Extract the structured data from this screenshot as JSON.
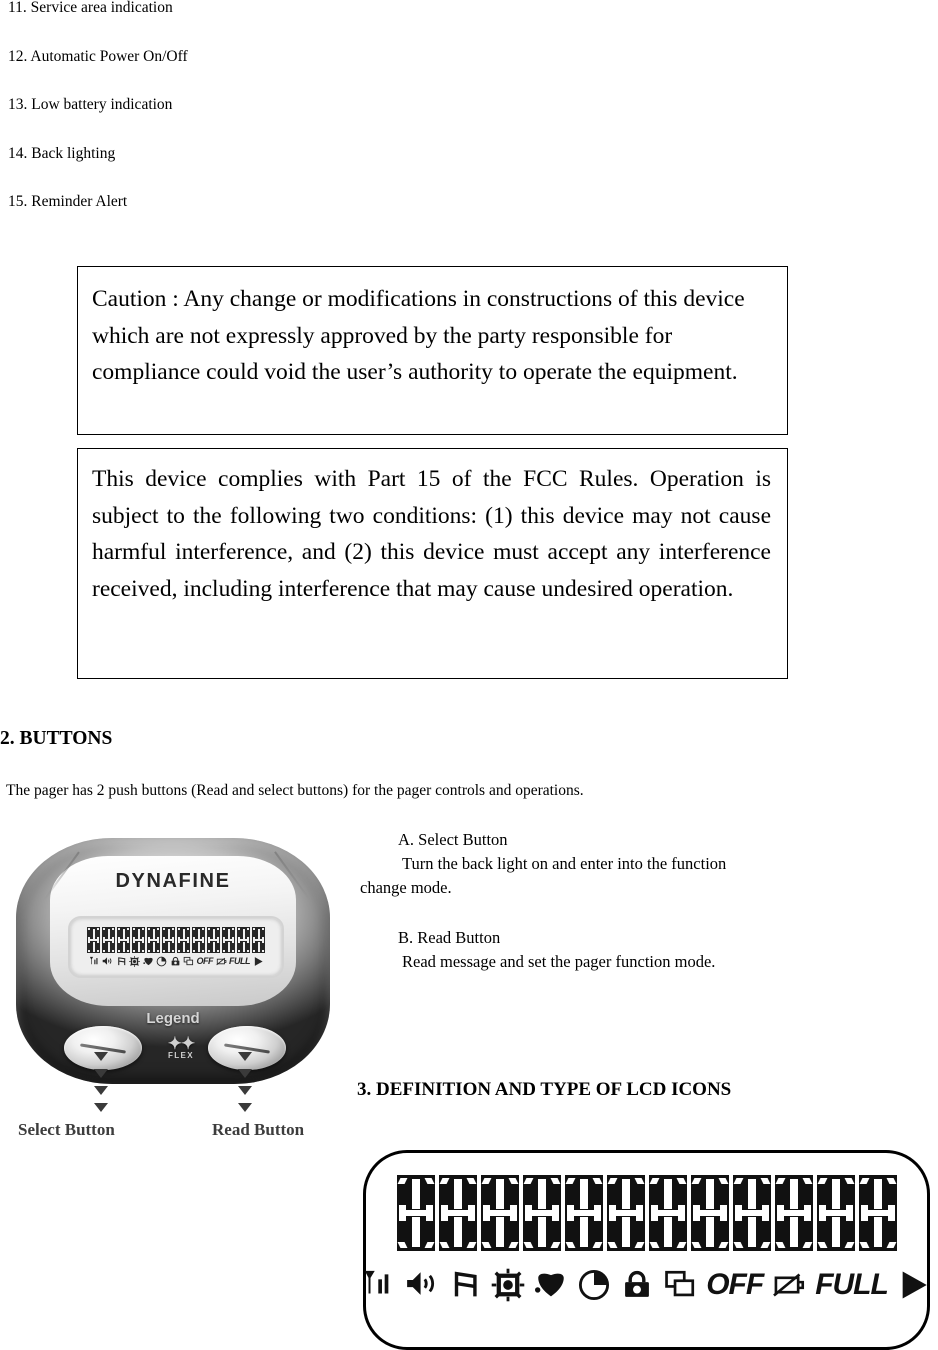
{
  "feature_list": [
    "11. Service area indication",
    "12. Automatic Power On/Off",
    "13. Low battery indication",
    "14. Back lighting",
    "15. Reminder Alert"
  ],
  "caution_box": {
    "text": "Caution : Any change or modifications in constructions of this device which are not expressly approved by the party responsible for compliance could void the user’s authority to operate the equipment."
  },
  "fcc_box": {
    "text": "This device complies with Part 15 of the FCC Rules. Operation is subject to the following two conditions: (1) this device may not cause harmful interference, and (2) this device must accept any interference received, including interference that may cause undesired operation."
  },
  "buttons_section": {
    "heading": "2. BUTTONS",
    "intro": "The pager has 2 push buttons (Read and select buttons) for the pager controls and operations.",
    "select": {
      "title": "A. Select Button",
      "line1": "Turn the back light on and enter into the function",
      "line2": "change mode."
    },
    "read": {
      "title": "B. Read Button",
      "line1": "Read message and set the pager function mode."
    }
  },
  "pager_figure": {
    "brand": "DYNAFINE",
    "legend_label": "Legend",
    "flex_mark": "✦✦",
    "flex_word": "FLEX",
    "select_callout": "Select Button",
    "read_callout": "Read Button"
  },
  "lcd_section": {
    "heading": "3. DEFINITION AND TYPE OF LCD ICONS",
    "segment_cell_count": 12,
    "icons": [
      {
        "name": "signal-antenna-icon",
        "label": ""
      },
      {
        "name": "speaker-sound-icon",
        "label": ""
      },
      {
        "name": "music-note-icon",
        "label": ""
      },
      {
        "name": "vibrate-alert-icon",
        "label": ""
      },
      {
        "name": "envelope-message-icon",
        "label": ""
      },
      {
        "name": "clock-icon",
        "label": ""
      },
      {
        "name": "lock-icon",
        "label": ""
      },
      {
        "name": "stacked-messages-icon",
        "label": ""
      },
      {
        "name": "off-text-icon",
        "label": "OFF"
      },
      {
        "name": "battery-empty-icon",
        "label": ""
      },
      {
        "name": "full-text-icon",
        "label": "FULL"
      },
      {
        "name": "play-arrow-icon",
        "label": ""
      }
    ]
  },
  "colors": {
    "ink": "#000000",
    "page_background": "#ffffff",
    "callout_gray": "#3d3d3d"
  }
}
